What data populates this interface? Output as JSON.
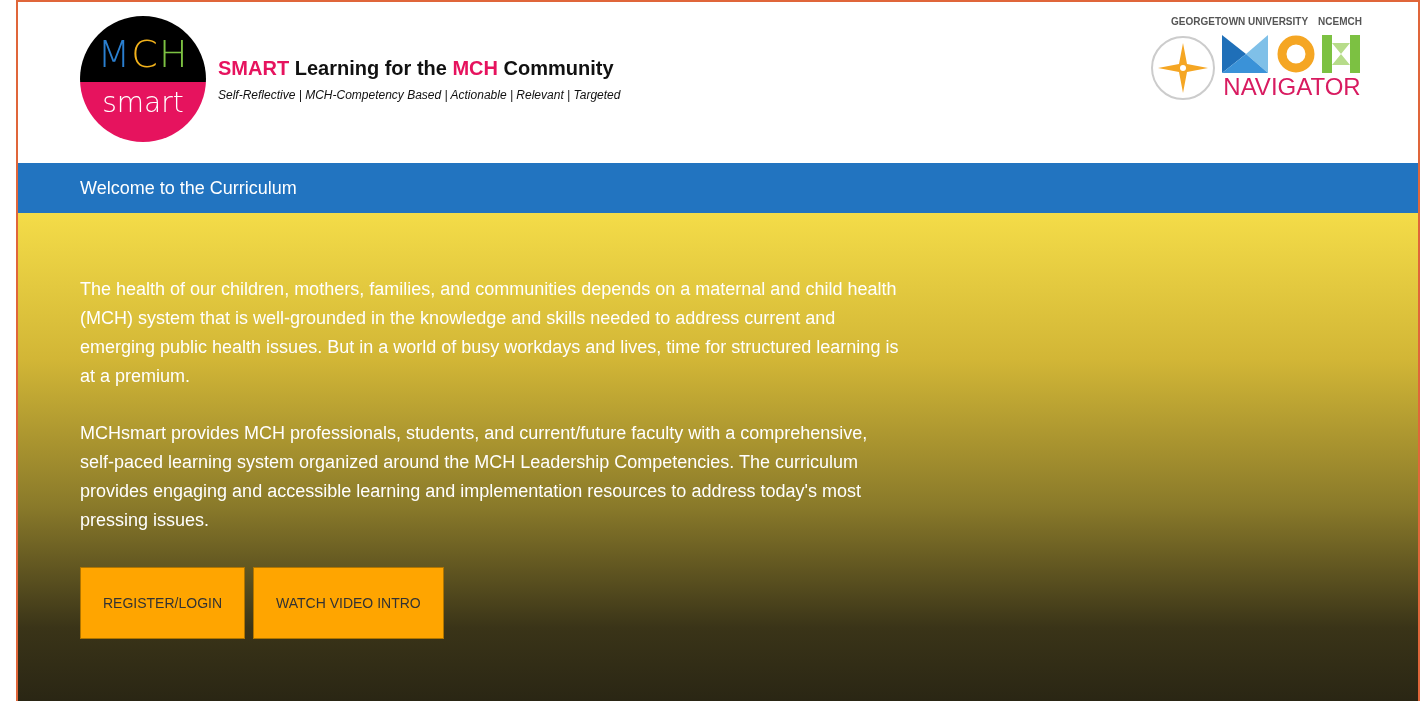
{
  "header": {
    "logo": {
      "letters": [
        {
          "text": "M",
          "color": "#2a7fd0"
        },
        {
          "text": "C",
          "color": "#f2b21b"
        },
        {
          "text": "H",
          "color": "#7cc142"
        }
      ],
      "word": "smart"
    },
    "title_parts": [
      {
        "text": "SMART",
        "highlight": true
      },
      {
        "text": " Learning for the ",
        "highlight": false
      },
      {
        "text": "MCH",
        "highlight": true
      },
      {
        "text": " Community",
        "highlight": false
      }
    ],
    "tagline": "Self-Reflective | MCH-Competency Based | Actionable | Relevant | Targeted",
    "partners": [
      "GEORGETOWN UNIVERSITY",
      "NCEMCH"
    ],
    "navigator": {
      "word": "NAVIGATOR"
    }
  },
  "nav_bar": {
    "title": "Welcome to the Curriculum"
  },
  "hero": {
    "paragraphs": [
      "The health of our children, mothers, families, and communities depends on a maternal and child health (MCH) system that is well-grounded in the knowledge and skills needed to address current and emerging public health issues. But in a world of busy workdays and lives, time for structured learning is at a premium.",
      "MCHsmart provides MCH professionals, students, and current/future faculty with a comprehensive, self-paced learning system organized around the MCH Leadership Competencies. The curriculum provides engaging and accessible learning and implementation resources to address today's most pressing issues."
    ],
    "buttons": [
      "REGISTER/LOGIN",
      "WATCH VIDEO INTRO"
    ]
  }
}
